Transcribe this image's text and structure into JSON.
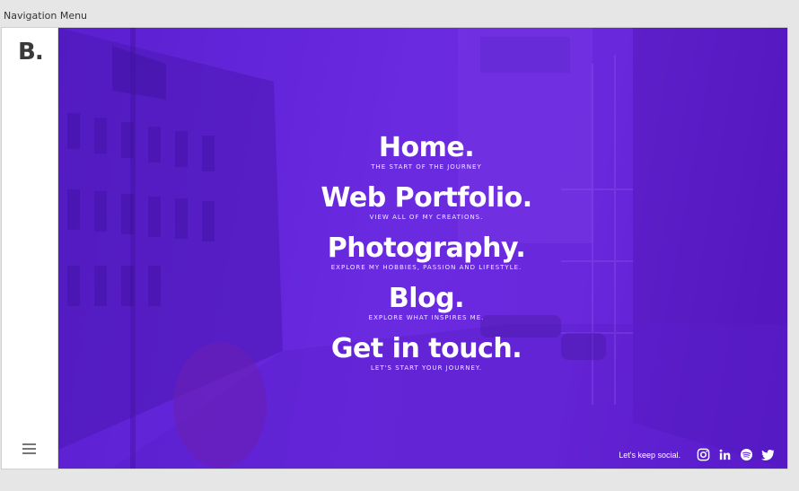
{
  "window": {
    "title": "Navigation Menu"
  },
  "sidebar": {
    "logo": "B."
  },
  "menu": {
    "items": [
      {
        "title": "Home.",
        "subtitle": "THE START OF THE JOURNEY"
      },
      {
        "title": "Web Portfolio.",
        "subtitle": "VIEW ALL OF MY CREATIONS."
      },
      {
        "title": "Photography.",
        "subtitle": "EXPLORE MY HOBBIES, PASSION AND LIFESTYLE."
      },
      {
        "title": "Blog.",
        "subtitle": "EXPLORE WHAT INSPIRES ME."
      },
      {
        "title": "Get in touch.",
        "subtitle": "LET'S START YOUR JOURNEY."
      }
    ]
  },
  "social": {
    "label": "Let's keep social.",
    "icons": [
      "instagram-icon",
      "linkedin-icon",
      "spotify-icon",
      "twitter-icon"
    ]
  },
  "colors": {
    "overlay": "#6a2ae0",
    "text": "#ffffff"
  }
}
